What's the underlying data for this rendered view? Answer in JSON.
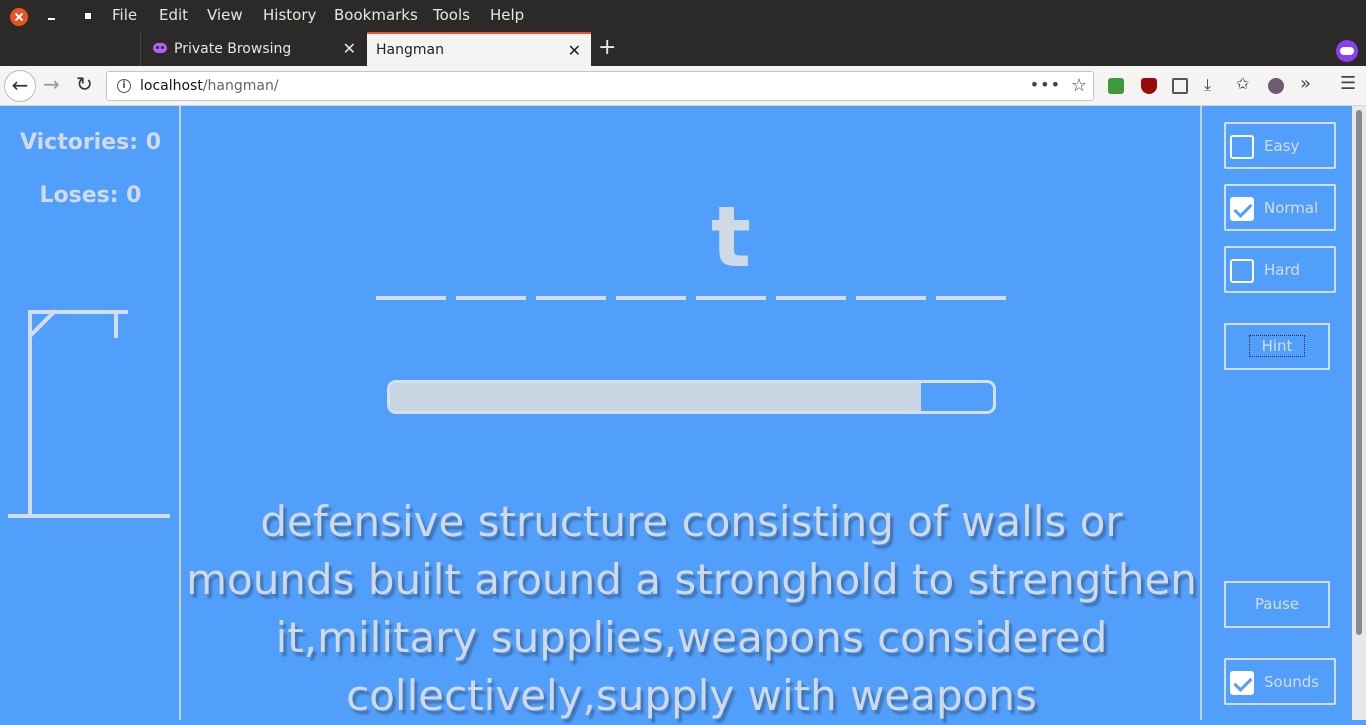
{
  "menubar": {
    "items": [
      "File",
      "Edit",
      "View",
      "History",
      "Bookmarks",
      "Tools",
      "Help"
    ]
  },
  "tabs": [
    {
      "label": "Private Browsing",
      "icon": "private-mask-icon"
    },
    {
      "label": "Hangman",
      "active": true
    }
  ],
  "urlbar": {
    "host": "localhost",
    "path": "/hangman/"
  },
  "game": {
    "victories_label": "Victories: 0",
    "loses_label": "Loses: 0",
    "slots": [
      "",
      "",
      "",
      "",
      "t",
      "",
      "",
      ""
    ],
    "timer_remaining_fraction": 0.88,
    "hint_text": "defensive structure consisting of walls or mounds built around a stronghold to strengthen it,military supplies,weapons considered collectively,supply with weapons"
  },
  "options": {
    "easy": {
      "label": "Easy",
      "checked": false
    },
    "normal": {
      "label": "Normal",
      "checked": true
    },
    "hard": {
      "label": "Hard",
      "checked": false
    },
    "hint_button": "Hint",
    "pause_button": "Pause",
    "sounds": {
      "label": "Sounds",
      "checked": true
    }
  },
  "colors": {
    "page_bg": "#529ffb",
    "accent_tab": "#e95420",
    "private": "#8a3ff0"
  }
}
